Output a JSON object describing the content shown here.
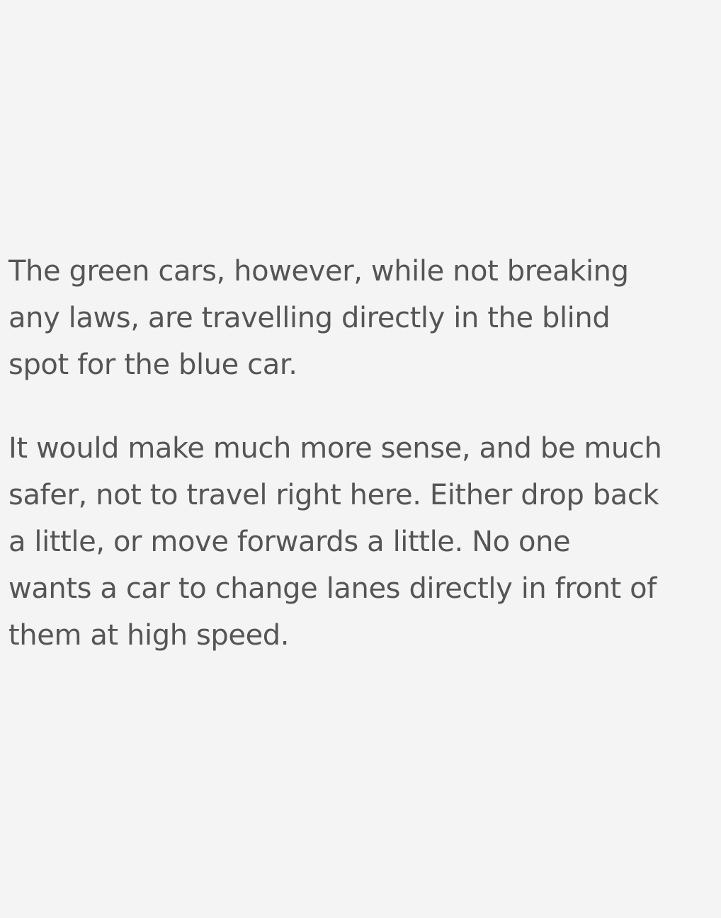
{
  "article": {
    "paragraphs": [
      {
        "lines": [
          "The green cars, however, while not breaking",
          "any laws, are travelling directly in the blind",
          "spot for the blue car."
        ]
      },
      {
        "lines": [
          "It would make much more sense, and be much",
          "safer, not to travel right here. Either drop back",
          "a little, or move forwards a little. No one",
          "wants a car to change lanes directly in front of",
          "them at high speed."
        ]
      }
    ]
  },
  "colors": {
    "background": "#f4f4f4",
    "text": "#555555"
  }
}
